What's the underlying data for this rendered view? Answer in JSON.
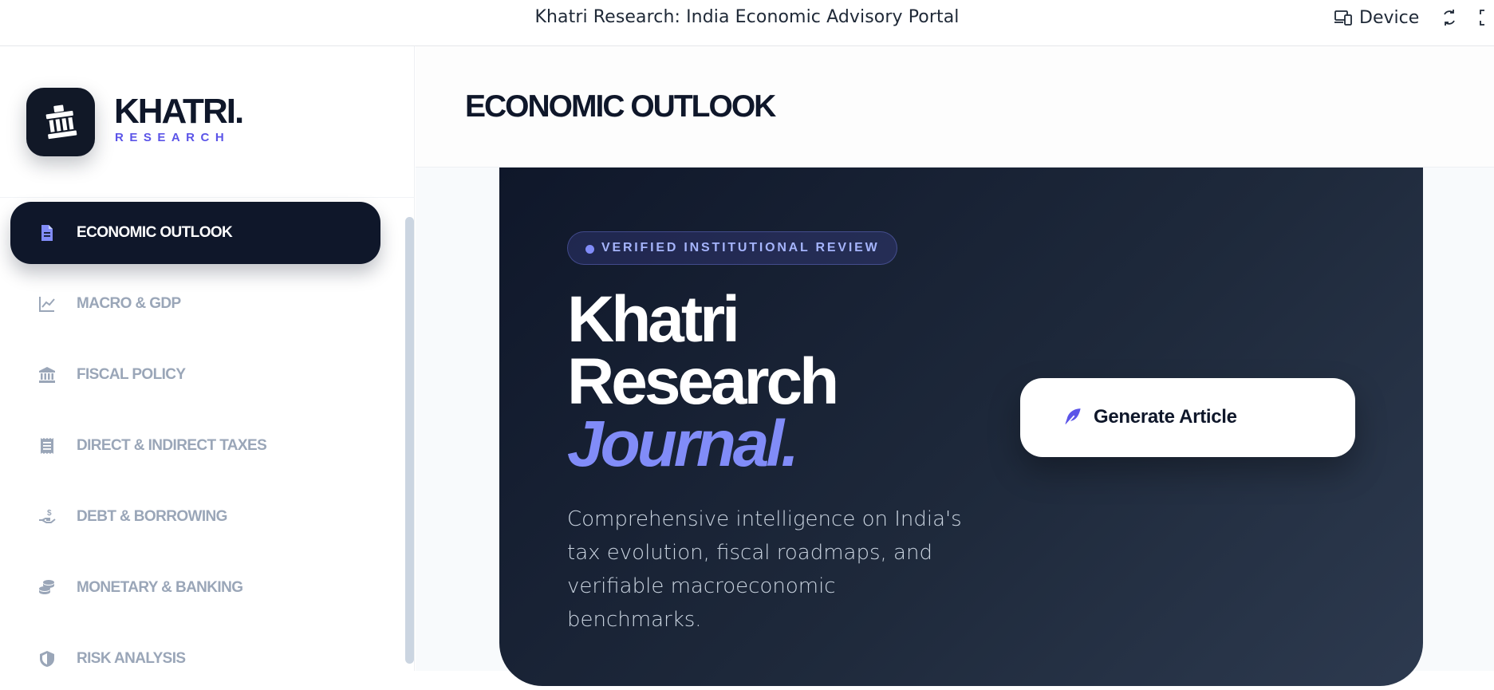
{
  "window": {
    "title": "Khatri Research: India Economic Advisory Portal",
    "device_label": "Device"
  },
  "brand": {
    "name": "KHATRI.",
    "subtitle": "RESEARCH"
  },
  "sidebar": {
    "items": [
      {
        "label": "ECONOMIC OUTLOOK",
        "icon": "document-icon",
        "active": true
      },
      {
        "label": "MACRO & GDP",
        "icon": "line-chart-icon",
        "active": false
      },
      {
        "label": "FISCAL POLICY",
        "icon": "bank-icon",
        "active": false
      },
      {
        "label": "DIRECT & INDIRECT TAXES",
        "icon": "receipt-icon",
        "active": false
      },
      {
        "label": "DEBT & BORROWING",
        "icon": "hand-dollar-icon",
        "active": false
      },
      {
        "label": "MONETARY & BANKING",
        "icon": "coins-icon",
        "active": false
      },
      {
        "label": "RISK ANALYSIS",
        "icon": "shield-icon",
        "active": false
      }
    ]
  },
  "main": {
    "page_title": "ECONOMIC OUTLOOK",
    "hero": {
      "badge": "VERIFIED INSTITUTIONAL REVIEW",
      "title_line1": "Khatri",
      "title_line2": "Research",
      "title_accent": "Journal.",
      "description": "Comprehensive intelligence on India's tax evolution, fiscal roadmaps, and verifiable macroeconomic benchmarks.",
      "button_label": "Generate Article"
    }
  },
  "colors": {
    "accent": "#818cf8",
    "brand_purple": "#5b54e8",
    "dark": "#0f172a",
    "muted": "#9aa6b8"
  }
}
